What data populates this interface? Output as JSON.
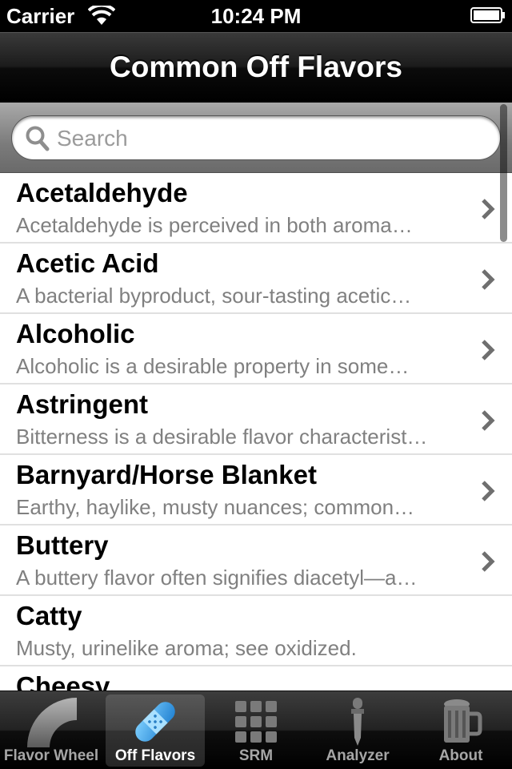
{
  "status_bar": {
    "carrier": "Carrier",
    "time": "10:24 PM",
    "wifi_icon": "wifi-icon",
    "battery_icon": "battery-icon"
  },
  "nav_bar": {
    "title": "Common Off Flavors"
  },
  "search": {
    "placeholder": "Search",
    "icon": "search-icon"
  },
  "list": {
    "items": [
      {
        "title": "Acetaldehyde",
        "subtitle": "Acetaldehyde is perceived in both aroma…",
        "has_disclosure": true
      },
      {
        "title": "Acetic Acid",
        "subtitle": "A bacterial byproduct, sour-tasting acetic…",
        "has_disclosure": true
      },
      {
        "title": "Alcoholic",
        "subtitle": "Alcoholic is a desirable property in some…",
        "has_disclosure": true
      },
      {
        "title": "Astringent",
        "subtitle": "Bitterness is a desirable flavor characterist…",
        "has_disclosure": true
      },
      {
        "title": "Barnyard/Horse Blanket",
        "subtitle": "Earthy, haylike, musty nuances; common…",
        "has_disclosure": true
      },
      {
        "title": "Buttery",
        "subtitle": "A buttery flavor often signifies diacetyl—a…",
        "has_disclosure": true
      },
      {
        "title": "Catty",
        "subtitle": "Musty, urinelike aroma; see oxidized.",
        "has_disclosure": false
      },
      {
        "title": "Cheesy",
        "subtitle": "",
        "has_disclosure": false
      }
    ]
  },
  "tab_bar": {
    "selected": 1,
    "tabs": [
      {
        "label": "Flavor Wheel",
        "icon": "flavor-wheel-icon"
      },
      {
        "label": "Off Flavors",
        "icon": "bandage-icon"
      },
      {
        "label": "SRM",
        "icon": "grid-icon"
      },
      {
        "label": "Analyzer",
        "icon": "dropper-icon"
      },
      {
        "label": "About",
        "icon": "beer-mug-icon"
      }
    ]
  },
  "colors": {
    "selected_tab_icon": "#3aa3e8",
    "unselected_tab_icon": "#8a8a8a"
  }
}
